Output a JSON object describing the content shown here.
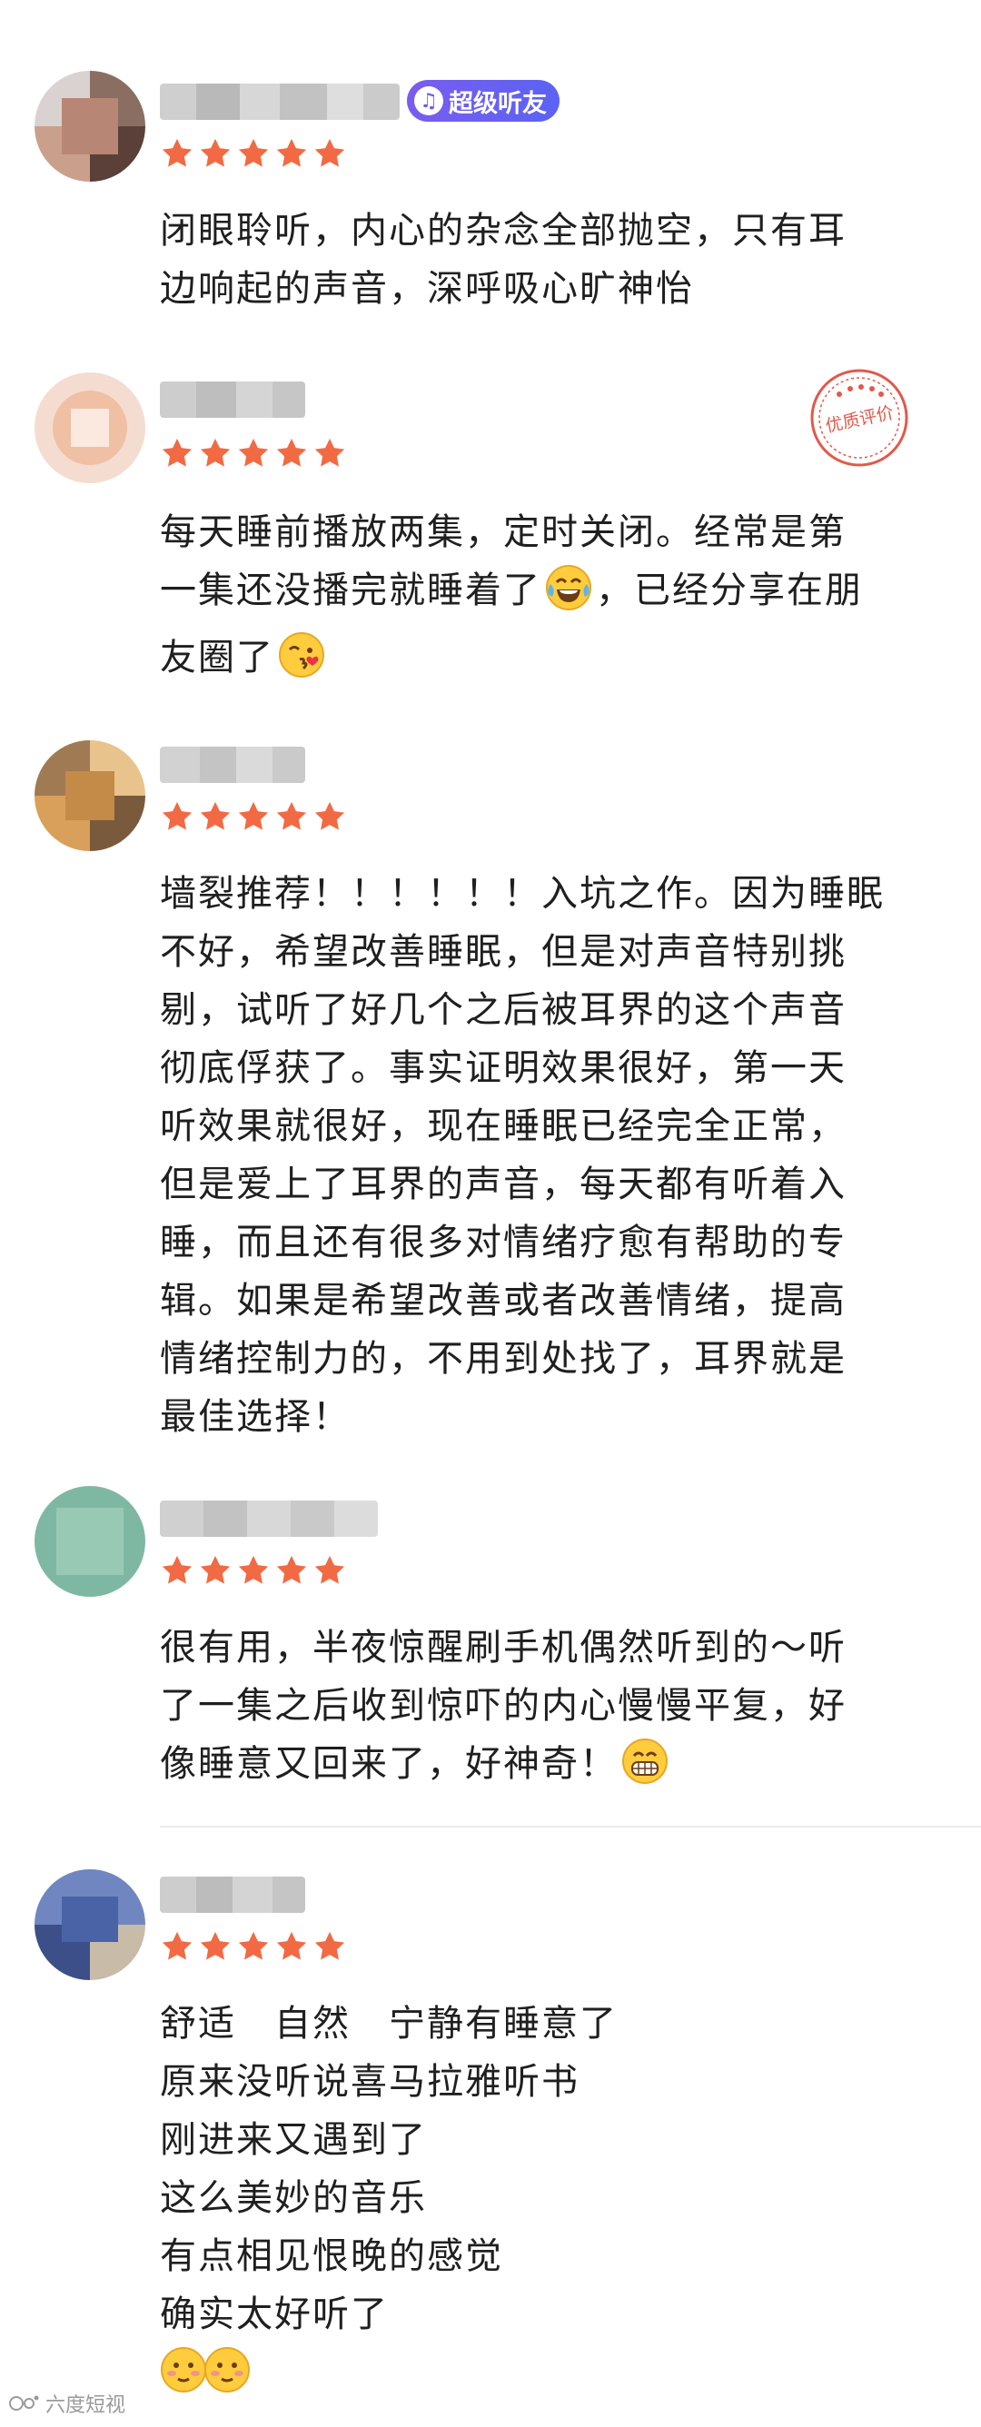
{
  "accent_star_color": "#f26a43",
  "vip_badge": {
    "label": "超级听友",
    "icon": "ear-icon"
  },
  "quality_stamp": {
    "label": "优质评价",
    "icon": "quality-stamp-icon"
  },
  "reviews": [
    {
      "rating": 5,
      "lines": [
        "闭眼聆听，内心的杂念全部抛空，只有耳",
        "边响起的声音，深呼吸心旷神怡"
      ]
    },
    {
      "rating": 5,
      "lines": [
        "每天睡前播放两集，定时关闭。经常是第",
        "一集还没播完就睡着了",
        "，已经分享在朋",
        "友圈了"
      ],
      "emojis": [
        "laughing-tears-emoji",
        "kissing-emoji"
      ]
    },
    {
      "rating": 5,
      "lines": [
        "墙裂推荐！！！！！！入坑之作。因为睡眠",
        "不好，希望改善睡眠，但是对声音特别挑",
        "剔，试听了好几个之后被耳界的这个声音",
        "彻底俘获了。事实证明效果很好，第一天",
        "听效果就很好，现在睡眠已经完全正常，",
        "但是爱上了耳界的声音，每天都有听着入",
        "睡，而且还有很多对情绪疗愈有帮助的专",
        "辑。如果是希望改善或者改善情绪，提高",
        "情绪控制力的，不用到处找了，耳界就是",
        "最佳选择！"
      ]
    },
    {
      "rating": 5,
      "lines": [
        "很有用，半夜惊醒刷手机偶然听到的～听",
        "了一集之后收到惊吓的内心慢慢平复，好",
        "像睡意又回来了，好神奇！"
      ],
      "emojis": [
        "grinning-emoji"
      ]
    },
    {
      "rating": 5,
      "lines": [
        "舒适　自然　宁静有睡意了",
        "原来没听说喜马拉雅听书",
        "刚进来又遇到了",
        "这么美妙的音乐",
        "有点相见恨晚的感觉",
        "确实太好听了"
      ],
      "emojis": [
        "blushing-emoji",
        "blushing-emoji"
      ]
    }
  ],
  "watermark": {
    "label": "六度短视",
    "icon": "watermark-logo-icon"
  }
}
